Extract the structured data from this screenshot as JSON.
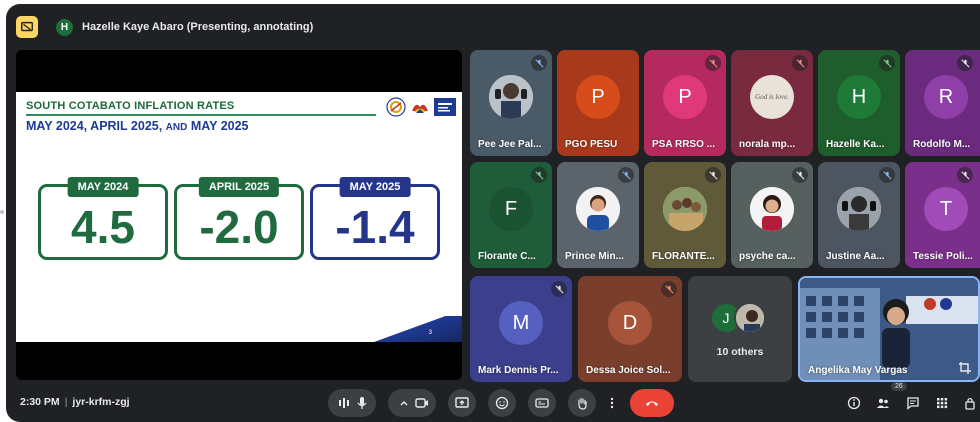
{
  "presenter": {
    "initial": "H",
    "label": "Hazelle Kaye Abaro (Presenting, annotating)"
  },
  "slide": {
    "title": "SOUTH COTABATO INFLATION RATES",
    "subtitle_a": "MAY 2024, APRIL 2025, ",
    "subtitle_and": "AND",
    "subtitle_b": " MAY 2025",
    "cards": [
      {
        "label": "MAY 2024",
        "value": "4.5"
      },
      {
        "label": "APRIL 2025",
        "value": "-2.0"
      },
      {
        "label": "MAY 2025",
        "value": "-1.4"
      }
    ],
    "page": "3"
  },
  "tiles": [
    {
      "name": "Pee Jee Pal...",
      "muted": true
    },
    {
      "name": "PGO PESU",
      "initial": "P",
      "muted": false
    },
    {
      "name": "PSA RRSO ...",
      "initial": "P",
      "muted": true
    },
    {
      "name": "norala mp...",
      "caption": "God is love.",
      "muted": true
    },
    {
      "name": "Hazelle Ka...",
      "initial": "H",
      "muted": true
    },
    {
      "name": "Rodolfo M...",
      "initial": "R",
      "muted": true
    },
    {
      "name": "Florante C...",
      "initial": "F",
      "muted": true
    },
    {
      "name": "Prince Min...",
      "muted": true
    },
    {
      "name": "FLORANTE...",
      "muted": true
    },
    {
      "name": "psyche ca...",
      "muted": true
    },
    {
      "name": "Justine Aa...",
      "muted": true
    },
    {
      "name": "Tessie Poli...",
      "initial": "T",
      "muted": true
    },
    {
      "name": "Mark Dennis Pr...",
      "initial": "M",
      "muted": true
    },
    {
      "name": "Dessa Joice Sol...",
      "initial": "D",
      "muted": true
    }
  ],
  "others": {
    "initial": "J",
    "label": "10 others"
  },
  "speaker": {
    "name": "Angelika May Vargas"
  },
  "bottombar": {
    "time": "2:30 PM",
    "meeting_code": "jyr-krfm-zgj",
    "people_count": "26"
  },
  "colors": {
    "background": "#202124",
    "control": "#3c4043",
    "end_call": "#ea4335",
    "present": "#fdd663"
  },
  "icons": [
    "present-icon",
    "mic-off-icon",
    "audio-bars-icon",
    "mic-icon",
    "chevron-up-icon",
    "camera-icon",
    "present-screen-icon",
    "emoji-icon",
    "captions-icon",
    "raise-hand-icon",
    "more-vert-icon",
    "end-call-icon",
    "info-icon",
    "people-icon",
    "chat-icon",
    "activities-icon",
    "host-controls-icon",
    "crop-icon"
  ]
}
